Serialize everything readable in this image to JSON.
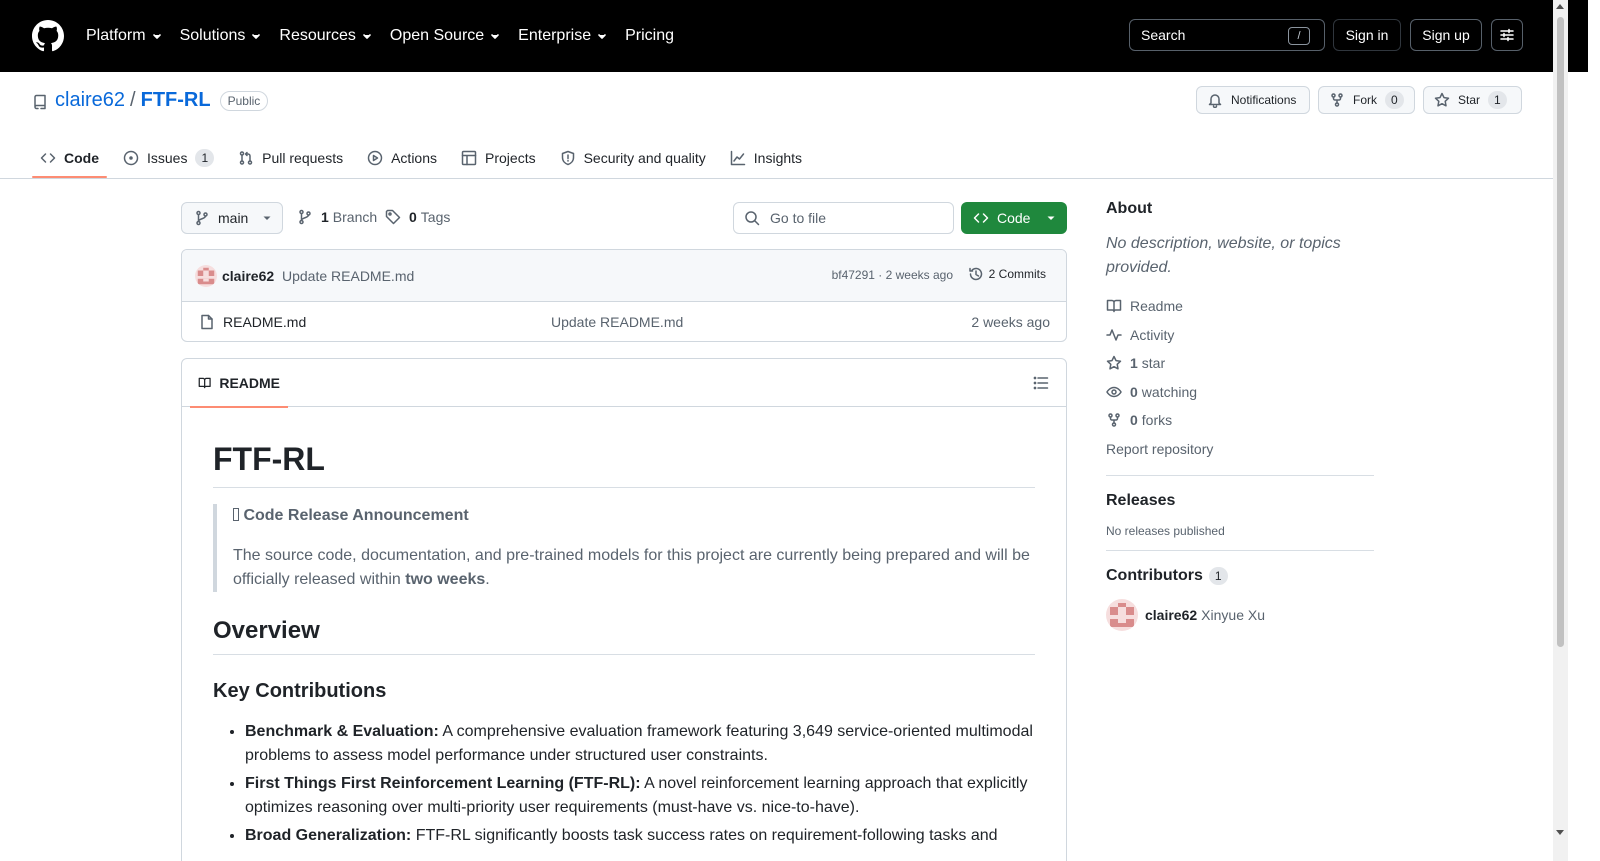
{
  "header": {
    "nav": [
      "Platform",
      "Solutions",
      "Resources",
      "Open Source",
      "Enterprise",
      "Pricing"
    ],
    "search_label": "Search",
    "search_shortcut": "/",
    "sign_in": "Sign in",
    "sign_up": "Sign up"
  },
  "repo": {
    "owner": "claire62",
    "separator": "/",
    "name": "FTF-RL",
    "visibility": "Public",
    "notifications": "Notifications",
    "fork_label": "Fork",
    "fork_count": "0",
    "star_label": "Star",
    "star_count": "1"
  },
  "tabs": {
    "code": "Code",
    "issues": "Issues",
    "issues_count": "1",
    "pulls": "Pull requests",
    "actions": "Actions",
    "projects": "Projects",
    "security": "Security and quality",
    "insights": "Insights"
  },
  "toolbar": {
    "branch": "main",
    "branch_count": "1",
    "branch_label": "Branch",
    "tag_count": "0",
    "tag_label": "Tags",
    "goto_placeholder": "Go to file",
    "code_button": "Code"
  },
  "commit": {
    "author": "claire62",
    "message": "Update README.md",
    "sha_time": "bf47291 · 2 weeks ago",
    "commits": "2 Commits"
  },
  "files": [
    {
      "name": "README.md",
      "message": "Update README.md",
      "date": "2 weeks ago"
    }
  ],
  "readme": {
    "tab": "README",
    "title": "FTF-RL",
    "notice_title": " Code Release Announcement",
    "notice_text": "The source code, documentation, and pre-trained models for this project are currently being prepared and will be officially released within ",
    "notice_bold": "two weeks",
    "notice_end": ".",
    "overview": "Overview",
    "key_contributions": "Key Contributions",
    "items": [
      {
        "bold": "Benchmark & Evaluation:",
        "text": " A comprehensive evaluation framework featuring 3,649 service-oriented multimodal problems to assess model performance under structured user constraints."
      },
      {
        "bold": "First Things First Reinforcement Learning (FTF-RL):",
        "text": " A novel reinforcement learning approach that explicitly optimizes reasoning over multi-priority user requirements (must-have vs. nice-to-have)."
      },
      {
        "bold": "Broad Generalization:",
        "text": " FTF-RL significantly boosts task success rates on requirement-following tasks and"
      }
    ]
  },
  "sidebar": {
    "about": "About",
    "description": "No description, website, or topics provided.",
    "readme": "Readme",
    "activity": "Activity",
    "stars_count": "1",
    "stars_label": "star",
    "watching_count": "0",
    "watching_label": "watching",
    "forks_count": "0",
    "forks_label": "forks",
    "report": "Report repository",
    "releases": "Releases",
    "no_releases": "No releases published",
    "contributors": "Contributors",
    "contributors_count": "1",
    "contributor_login": "claire62",
    "contributor_name": "Xinyue Xu"
  },
  "colors": {
    "accent_link": "#0969da",
    "primary_button": "#1f883d",
    "tab_underline": "#fd8c73",
    "header_bg": "#000000"
  }
}
